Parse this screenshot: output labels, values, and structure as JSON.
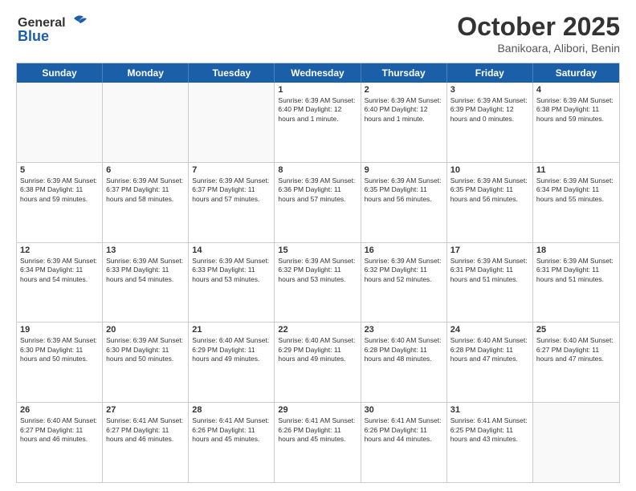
{
  "logo": {
    "line1": "General",
    "line2": "Blue"
  },
  "title": "October 2025",
  "location": "Banikoara, Alibori, Benin",
  "header_days": [
    "Sunday",
    "Monday",
    "Tuesday",
    "Wednesday",
    "Thursday",
    "Friday",
    "Saturday"
  ],
  "weeks": [
    [
      {
        "day": "",
        "text": ""
      },
      {
        "day": "",
        "text": ""
      },
      {
        "day": "",
        "text": ""
      },
      {
        "day": "1",
        "text": "Sunrise: 6:39 AM\nSunset: 6:40 PM\nDaylight: 12 hours\nand 1 minute."
      },
      {
        "day": "2",
        "text": "Sunrise: 6:39 AM\nSunset: 6:40 PM\nDaylight: 12 hours\nand 1 minute."
      },
      {
        "day": "3",
        "text": "Sunrise: 6:39 AM\nSunset: 6:39 PM\nDaylight: 12 hours\nand 0 minutes."
      },
      {
        "day": "4",
        "text": "Sunrise: 6:39 AM\nSunset: 6:38 PM\nDaylight: 11 hours\nand 59 minutes."
      }
    ],
    [
      {
        "day": "5",
        "text": "Sunrise: 6:39 AM\nSunset: 6:38 PM\nDaylight: 11 hours\nand 59 minutes."
      },
      {
        "day": "6",
        "text": "Sunrise: 6:39 AM\nSunset: 6:37 PM\nDaylight: 11 hours\nand 58 minutes."
      },
      {
        "day": "7",
        "text": "Sunrise: 6:39 AM\nSunset: 6:37 PM\nDaylight: 11 hours\nand 57 minutes."
      },
      {
        "day": "8",
        "text": "Sunrise: 6:39 AM\nSunset: 6:36 PM\nDaylight: 11 hours\nand 57 minutes."
      },
      {
        "day": "9",
        "text": "Sunrise: 6:39 AM\nSunset: 6:35 PM\nDaylight: 11 hours\nand 56 minutes."
      },
      {
        "day": "10",
        "text": "Sunrise: 6:39 AM\nSunset: 6:35 PM\nDaylight: 11 hours\nand 56 minutes."
      },
      {
        "day": "11",
        "text": "Sunrise: 6:39 AM\nSunset: 6:34 PM\nDaylight: 11 hours\nand 55 minutes."
      }
    ],
    [
      {
        "day": "12",
        "text": "Sunrise: 6:39 AM\nSunset: 6:34 PM\nDaylight: 11 hours\nand 54 minutes."
      },
      {
        "day": "13",
        "text": "Sunrise: 6:39 AM\nSunset: 6:33 PM\nDaylight: 11 hours\nand 54 minutes."
      },
      {
        "day": "14",
        "text": "Sunrise: 6:39 AM\nSunset: 6:33 PM\nDaylight: 11 hours\nand 53 minutes."
      },
      {
        "day": "15",
        "text": "Sunrise: 6:39 AM\nSunset: 6:32 PM\nDaylight: 11 hours\nand 53 minutes."
      },
      {
        "day": "16",
        "text": "Sunrise: 6:39 AM\nSunset: 6:32 PM\nDaylight: 11 hours\nand 52 minutes."
      },
      {
        "day": "17",
        "text": "Sunrise: 6:39 AM\nSunset: 6:31 PM\nDaylight: 11 hours\nand 51 minutes."
      },
      {
        "day": "18",
        "text": "Sunrise: 6:39 AM\nSunset: 6:31 PM\nDaylight: 11 hours\nand 51 minutes."
      }
    ],
    [
      {
        "day": "19",
        "text": "Sunrise: 6:39 AM\nSunset: 6:30 PM\nDaylight: 11 hours\nand 50 minutes."
      },
      {
        "day": "20",
        "text": "Sunrise: 6:39 AM\nSunset: 6:30 PM\nDaylight: 11 hours\nand 50 minutes."
      },
      {
        "day": "21",
        "text": "Sunrise: 6:40 AM\nSunset: 6:29 PM\nDaylight: 11 hours\nand 49 minutes."
      },
      {
        "day": "22",
        "text": "Sunrise: 6:40 AM\nSunset: 6:29 PM\nDaylight: 11 hours\nand 49 minutes."
      },
      {
        "day": "23",
        "text": "Sunrise: 6:40 AM\nSunset: 6:28 PM\nDaylight: 11 hours\nand 48 minutes."
      },
      {
        "day": "24",
        "text": "Sunrise: 6:40 AM\nSunset: 6:28 PM\nDaylight: 11 hours\nand 47 minutes."
      },
      {
        "day": "25",
        "text": "Sunrise: 6:40 AM\nSunset: 6:27 PM\nDaylight: 11 hours\nand 47 minutes."
      }
    ],
    [
      {
        "day": "26",
        "text": "Sunrise: 6:40 AM\nSunset: 6:27 PM\nDaylight: 11 hours\nand 46 minutes."
      },
      {
        "day": "27",
        "text": "Sunrise: 6:41 AM\nSunset: 6:27 PM\nDaylight: 11 hours\nand 46 minutes."
      },
      {
        "day": "28",
        "text": "Sunrise: 6:41 AM\nSunset: 6:26 PM\nDaylight: 11 hours\nand 45 minutes."
      },
      {
        "day": "29",
        "text": "Sunrise: 6:41 AM\nSunset: 6:26 PM\nDaylight: 11 hours\nand 45 minutes."
      },
      {
        "day": "30",
        "text": "Sunrise: 6:41 AM\nSunset: 6:26 PM\nDaylight: 11 hours\nand 44 minutes."
      },
      {
        "day": "31",
        "text": "Sunrise: 6:41 AM\nSunset: 6:25 PM\nDaylight: 11 hours\nand 43 minutes."
      },
      {
        "day": "",
        "text": ""
      }
    ]
  ]
}
